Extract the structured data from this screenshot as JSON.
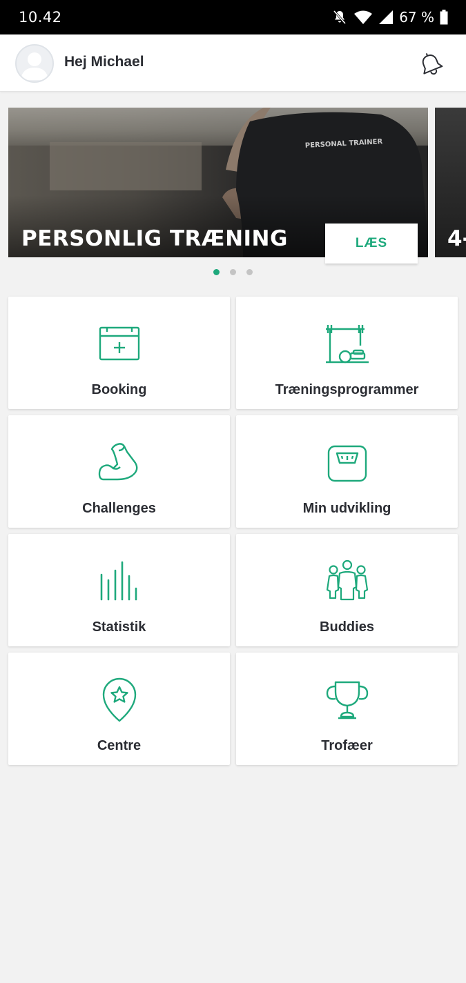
{
  "status_bar": {
    "time": "10.42",
    "battery": "67 %"
  },
  "header": {
    "greeting": "Hej Michael"
  },
  "carousel": {
    "slides": [
      {
        "title": "PERSONLIG TRÆNING",
        "button_label": "LÆS",
        "shirt_text": "PERSONAL TRAINER"
      },
      {
        "title": "4-"
      }
    ],
    "dots_count": 3,
    "active_dot": 0
  },
  "menu": {
    "items": [
      {
        "label": "Booking",
        "icon": "calendar-plus-icon"
      },
      {
        "label": "Træningsprogrammer",
        "icon": "barbell-rack-icon"
      },
      {
        "label": "Challenges",
        "icon": "flexed-arm-icon"
      },
      {
        "label": "Min udvikling",
        "icon": "scale-icon"
      },
      {
        "label": "Statistik",
        "icon": "bar-chart-icon"
      },
      {
        "label": "Buddies",
        "icon": "group-icon"
      },
      {
        "label": "Centre",
        "icon": "location-star-icon"
      },
      {
        "label": "Trofæer",
        "icon": "trophy-icon"
      }
    ]
  },
  "colors": {
    "accent": "#1ea97c",
    "text": "#2b2d33",
    "background": "#f2f2f2"
  }
}
